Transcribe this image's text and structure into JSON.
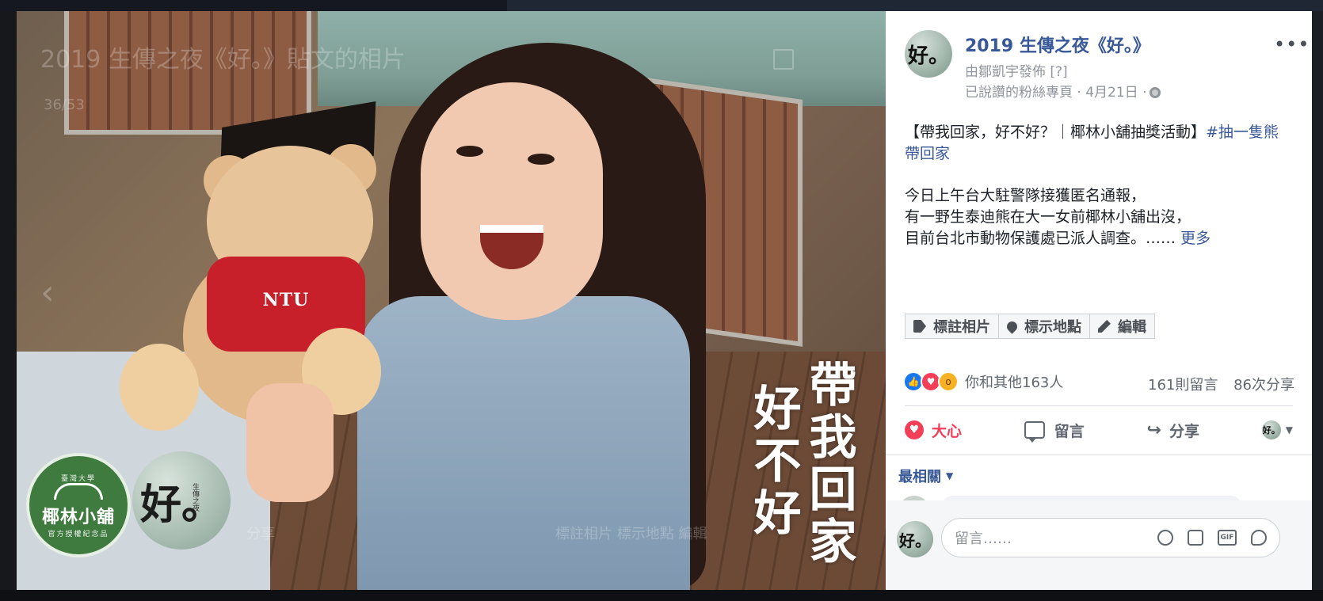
{
  "photo": {
    "ghost_title": "2019 生傳之夜《好。》貼文的相片",
    "ghost_count": "36/53",
    "ghost_share": "分享",
    "ghost_labels": "標註相片  標示地點  編輯",
    "vertical_line_1": "帶我回家",
    "vertical_line_2": "好不好",
    "shirt_text": "NTU",
    "badge_shop_top": "臺灣大學",
    "badge_shop_name": "椰林小舖",
    "badge_shop_bottom": "官方授權紀念品",
    "badge_good_char": "好。",
    "badge_good_side": "生傳之夜"
  },
  "post": {
    "page_name": "2019 生傳之夜《好。》",
    "posted_by": "由鄒凱宇發佈 [?]",
    "meta": "已說讚的粉絲專頁 · 4月21日 ·",
    "more": "•••",
    "avatar_char": "好。",
    "title_text": "【帶我回家，好不好？｜椰林小舖抽獎活動】",
    "hashtag": "#抽一隻熊帶回家",
    "body_line_1": "今日上午台大駐警隊接獲匿名通報，",
    "body_line_2": "有一野生泰迪熊在大一女前椰林小舖出沒，",
    "body_line_3": "目前台北市動物保護處已派人調查。……",
    "see_more": "更多"
  },
  "photo_actions": {
    "tag_photo": "標註相片",
    "tag_location": "標示地點",
    "edit": "編輯"
  },
  "engagement": {
    "reaction_summary": "你和其他163人",
    "comments": "161則留言",
    "shares": "86次分享"
  },
  "action_bar": {
    "love": "大心",
    "comment": "留言",
    "share": "分享"
  },
  "comments": {
    "sort_label": "最相關",
    "composer_placeholder": "留言……",
    "gif_label": "GIF"
  }
}
